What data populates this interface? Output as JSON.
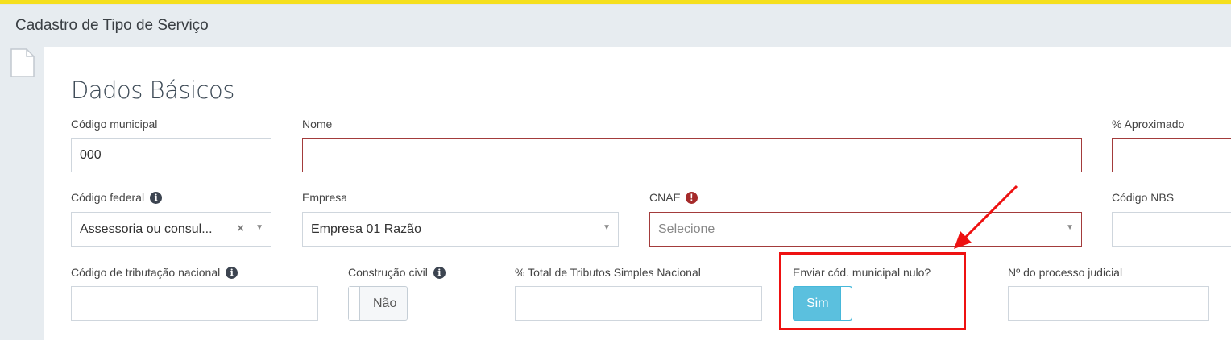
{
  "header": {
    "title": "Cadastro de Tipo de Serviço"
  },
  "section": {
    "title": "Dados Básicos"
  },
  "fields": {
    "codigo_municipal": {
      "label": "Código municipal",
      "value": "000"
    },
    "nome": {
      "label": "Nome",
      "value": ""
    },
    "aproximado": {
      "label": "% Aproximado",
      "value": ""
    },
    "codigo_federal": {
      "label": "Código federal",
      "value": "Assessoria ou consul..."
    },
    "empresa": {
      "label": "Empresa",
      "value": "Empresa 01 Razão"
    },
    "cnae": {
      "label": "CNAE",
      "placeholder": "Selecione"
    },
    "codigo_nbs": {
      "label": "Código NBS",
      "value": ""
    },
    "codigo_tributacao": {
      "label": "Código de tributação nacional",
      "value": ""
    },
    "construcao_civil": {
      "label": "Construção civil",
      "value": "Não",
      "on": false
    },
    "total_tributos": {
      "label": "% Total de Tributos Simples Nacional",
      "value": ""
    },
    "enviar_cod": {
      "label": "Enviar cód. municipal nulo?",
      "value": "Sim",
      "on": true
    },
    "processo_judicial": {
      "label": "Nº do processo judicial",
      "value": ""
    }
  },
  "icons": {
    "info": "info-circle-icon",
    "warning": "exclamation-circle-icon",
    "document": "document-icon"
  },
  "colors": {
    "accent_stripe": "#f5df1e",
    "toggle_on": "#5bc0de",
    "error_border": "#a33b3b",
    "callout": "#ee1111"
  }
}
